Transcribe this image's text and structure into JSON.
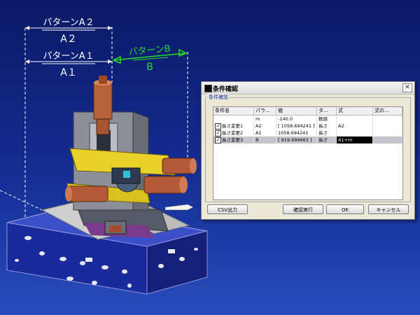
{
  "dimensions": {
    "a2_label": "パターンA２",
    "a2_value": "A２",
    "a1_label": "パターンA１",
    "a1_value": "A１",
    "b_label": "パターンB",
    "b_value": "B"
  },
  "dialog": {
    "title": "条件確認",
    "group_label": "条件確認",
    "close_glyph": "✕",
    "columns": [
      "条件名",
      "パラ...",
      "値",
      "タ...",
      "式",
      "式の..."
    ],
    "rows": [
      {
        "checked": false,
        "name": "",
        "param": "m",
        "value": "-140.0",
        "type": "数値",
        "formula": "",
        "formula_note": ""
      },
      {
        "checked": true,
        "name": "長さ変更1",
        "param": "A2",
        "value": "[ 1058.694241 ]",
        "type": "長さ",
        "formula": "A2",
        "formula_note": ""
      },
      {
        "checked": true,
        "name": "長さ変更2",
        "param": "A1",
        "value": "1058.694241",
        "type": "長さ",
        "formula": "",
        "formula_note": ""
      },
      {
        "checked": true,
        "name": "長さ変更3",
        "param": "B",
        "value": "[ 919.999663 ]",
        "type": "長さ",
        "formula": "A1+m",
        "formula_note": ""
      }
    ],
    "buttons": {
      "csv": "CSV出力",
      "confirm": "確認実行",
      "ok": "OK",
      "cancel": "キャンセル"
    }
  },
  "colors": {
    "background_top": "#0a1a66",
    "dimension_white": "#ffffff",
    "dimension_green": "#22dd22",
    "row_selected": "#c4c4cc",
    "formula_selected": "#000000"
  }
}
